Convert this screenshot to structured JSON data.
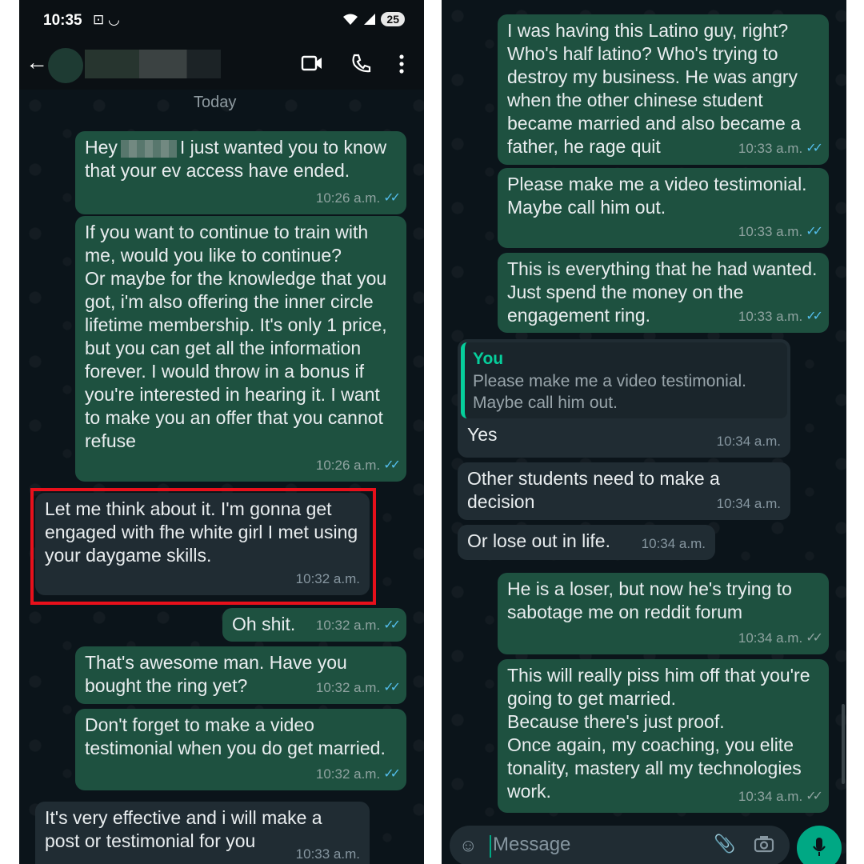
{
  "left": {
    "status": {
      "time": "10:35",
      "extra_icons": "⊡ ◡",
      "battery": "25"
    },
    "date_chip": "Today",
    "messages": [
      {
        "greeting": "Hey",
        "rest": "I just wanted you to know that your ev access have ended.",
        "time": "10:26 a.m."
      },
      {
        "text": "If you want to continue to train with me, would you like to continue?\nOr maybe for the knowledge that you got, i'm also offering the inner circle lifetime membership. It's only 1 price, but you can get all the information forever. I would throw in a bonus if you're interested in hearing it. I want to make you an offer that you cannot refuse",
        "time": "10:26 a.m."
      },
      {
        "text": "Let me think about it. I'm gonna get engaged with fhe white girl I met using your daygame skills.",
        "time": "10:32 a.m."
      },
      {
        "text": "Oh shit.",
        "time": "10:32 a.m."
      },
      {
        "text": "That's awesome man. Have you bought the ring yet?",
        "time": "10:32 a.m."
      },
      {
        "text": "Don't forget to make a video testimonial when you do get married.",
        "time": "10:32 a.m."
      },
      {
        "text": "It's very effective and i will make a post or testimonial for you",
        "time": "10:33 a.m."
      }
    ]
  },
  "right": {
    "messages": [
      {
        "text": "I was having this Latino guy, right? Who's half latino? Who's trying to destroy my business. He was angry when the other chinese student became married and also became a father, he rage quit",
        "time": "10:33 a.m."
      },
      {
        "text": "Please make me a video testimonial. Maybe call him out.",
        "time": "10:33 a.m."
      },
      {
        "text": "This is everything that he had wanted. Just spend the money on the engagement ring.",
        "time": "10:33 a.m."
      },
      {
        "quote_author": "You",
        "quote_text": "Please make me a video testimonial.\nMaybe call him out.",
        "text": "Yes",
        "time": "10:34 a.m."
      },
      {
        "text": "Other students need to make a decision",
        "time": "10:34 a.m."
      },
      {
        "text": "Or lose out in life.",
        "time": "10:34 a.m."
      },
      {
        "text": "He is a loser, but now he's trying to sabotage me on reddit forum",
        "time": "10:34 a.m."
      },
      {
        "text": "This will really piss him off that you're going to get married.\nBecause there's just proof.\nOnce again, my coaching, you elite tonality, mastery all my technologies work.",
        "time": "10:34 a.m."
      }
    ],
    "input": {
      "placeholder": "Message"
    }
  },
  "colors": {
    "outgoing": "#1e5140",
    "incoming": "#202c33",
    "accent": "#00a884",
    "read_ticks": "#53bdeb",
    "highlight": "#e8101b"
  },
  "icons": [
    "back-arrow-icon",
    "video-call-icon",
    "phone-icon",
    "more-vert-icon",
    "emoji-icon",
    "attach-icon",
    "camera-icon",
    "mic-icon",
    "read-ticks-icon"
  ]
}
